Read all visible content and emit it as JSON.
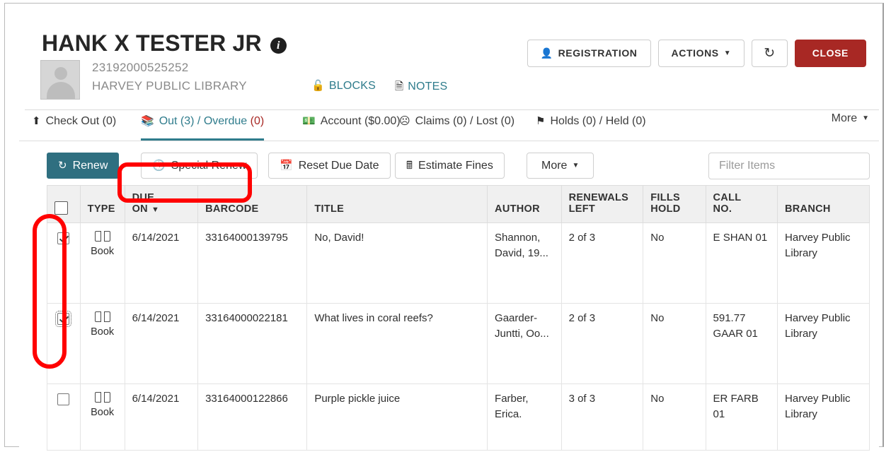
{
  "patron": {
    "name": "HANK X TESTER JR",
    "info_icon": "info-icon",
    "barcode": "23192000525252",
    "library": "HARVEY PUBLIC LIBRARY",
    "blocks_label": "BLOCKS",
    "notes_label": "NOTES"
  },
  "header_buttons": {
    "registration": "REGISTRATION",
    "actions": "ACTIONS",
    "refresh": "↻",
    "close": "CLOSE"
  },
  "patron_tabs": {
    "checkout": "Check Out (0)",
    "out_label": "Out (3) / Overdue ",
    "out_overdue": "(0)",
    "account": "Account ($0.00)",
    "claims": "Claims (0) / Lost (0)",
    "holds": "Holds (0) / Held (0)",
    "more": "More"
  },
  "toolbar": {
    "renew": "Renew",
    "special_renew": "Special Renew",
    "reset_due_date": "Reset Due Date",
    "estimate_fines": "Estimate Fines",
    "more": "More",
    "filter_placeholder": "Filter Items"
  },
  "table": {
    "columns": [
      {
        "key": "check",
        "label": ""
      },
      {
        "key": "type",
        "label": "TYPE"
      },
      {
        "key": "due_on_1",
        "label": "DUE"
      },
      {
        "key": "due_on_2",
        "label": "ON"
      },
      {
        "key": "barcode",
        "label": "BARCODE"
      },
      {
        "key": "title",
        "label": "TITLE"
      },
      {
        "key": "author",
        "label": "AUTHOR"
      },
      {
        "key": "renewals_left_1",
        "label": "RENEWALS"
      },
      {
        "key": "renewals_left_2",
        "label": "LEFT"
      },
      {
        "key": "fills_hold_1",
        "label": "FILLS"
      },
      {
        "key": "fills_hold_2",
        "label": "HOLD"
      },
      {
        "key": "call_no_1",
        "label": "CALL"
      },
      {
        "key": "call_no_2",
        "label": "NO."
      },
      {
        "key": "branch",
        "label": "BRANCH"
      }
    ],
    "sort_indicator": "▼",
    "rows": [
      {
        "checked": "checked",
        "type": "Book",
        "due_on": "6/14/2021",
        "barcode": "33164000139795",
        "title": "No, David!",
        "author": "Shannon, David, 19...",
        "renewals_left": "2 of 3",
        "fills_hold": "No",
        "call_no": "E SHAN 01",
        "branch": "Harvey Public Library"
      },
      {
        "checked": "checked-focused",
        "type": "Book",
        "due_on": "6/14/2021",
        "barcode": "33164000022181",
        "title": "What lives in coral reefs?",
        "author": "Gaarder-Juntti, Oo...",
        "renewals_left": "2 of 3",
        "fills_hold": "No",
        "call_no": "591.77 GAAR 01",
        "branch": "Harvey Public Library"
      },
      {
        "checked": "unchecked",
        "type": "Book",
        "due_on": "6/14/2021",
        "barcode": "33164000122866",
        "title": "Purple pickle juice",
        "author": "Farber, Erica.",
        "renewals_left": "3 of 3",
        "fills_hold": "No",
        "call_no": "ER FARB 01",
        "branch": "Harvey Public Library"
      }
    ]
  },
  "colors": {
    "accent_teal": "#2f7c8c",
    "primary_button": "#2f6f80",
    "danger_red": "#a82824",
    "annotation_red": "#ff0000",
    "header_row": "#f0f0f0"
  },
  "annotations": [
    {
      "name": "special-renew-highlight",
      "shape": "rounded-rect",
      "color": "#ff0000"
    },
    {
      "name": "checkbox-column-highlight",
      "shape": "rounded-rect",
      "color": "#ff0000"
    }
  ]
}
